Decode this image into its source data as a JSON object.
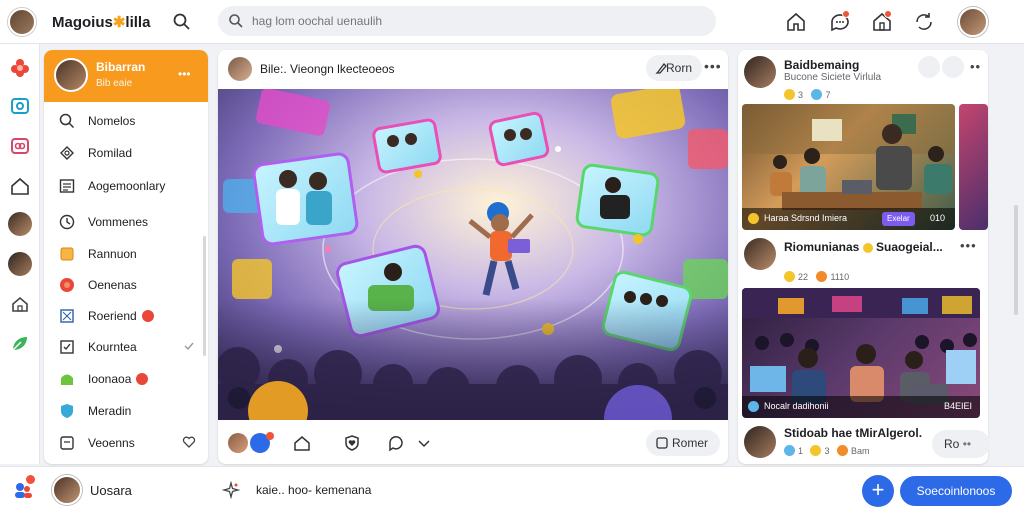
{
  "header": {
    "brand": "Magoius",
    "brand_suffix": "lilla",
    "search_placeholder": "hag lom oochal uenaulih"
  },
  "sidebar": {
    "profile": {
      "name": "Bibarran",
      "subtitle": "Bib eaie"
    },
    "items": [
      {
        "label": "Nomelos",
        "icon": "search-icon"
      },
      {
        "label": "Romilad",
        "icon": "puzzle-icon"
      },
      {
        "label": "Aogemoonlary",
        "icon": "calendar-icon"
      },
      {
        "label": "Vommenes",
        "icon": "clock-icon"
      },
      {
        "label": "Rannuon",
        "icon": "square-icon"
      },
      {
        "label": "Oenenas",
        "icon": "record-icon"
      },
      {
        "label": "Roeriend",
        "icon": "flag-icon"
      },
      {
        "label": "Kourntea",
        "icon": "check-square-icon"
      },
      {
        "label": "Ioonaoa",
        "icon": "bag-icon"
      },
      {
        "label": "Meradin",
        "icon": "shield-icon"
      },
      {
        "label": "Veoenns",
        "icon": "chat-icon"
      }
    ]
  },
  "post": {
    "title": "Bile:. Vieongn lkecteoeos",
    "action_label": "Rorn",
    "more_label": "Romer"
  },
  "feed": [
    {
      "name": "Baidbemaing",
      "subtitle": "Bucone Siciete Virlula",
      "counts": [
        "3",
        "7"
      ]
    },
    {
      "name": "Riomunianas",
      "name_suffix": "Suaogeial...",
      "thumb_text": "Haraa Sdrsnd Imiera",
      "thumb_pill": "Exelar",
      "thumb_right": "010",
      "counts": [
        "22",
        "1110"
      ]
    },
    {
      "name": "Stidoab hae",
      "name_suffix": "tMirAlgerol.",
      "thumb_text": "Nocalr dadihonii",
      "thumb_right": "B4EIEI",
      "counts": [
        "1",
        "3",
        "Bam"
      ]
    }
  ],
  "follow_label": "Ro",
  "bottom": {
    "user_name": "Uosara",
    "compose_text": "kaie.. hoo- kemenana",
    "cta_label": "Soecoinlonoos"
  },
  "colors": {
    "accent_orange": "#f79a1e",
    "primary_blue": "#2d6ae8",
    "badge_red": "#e8473a"
  }
}
